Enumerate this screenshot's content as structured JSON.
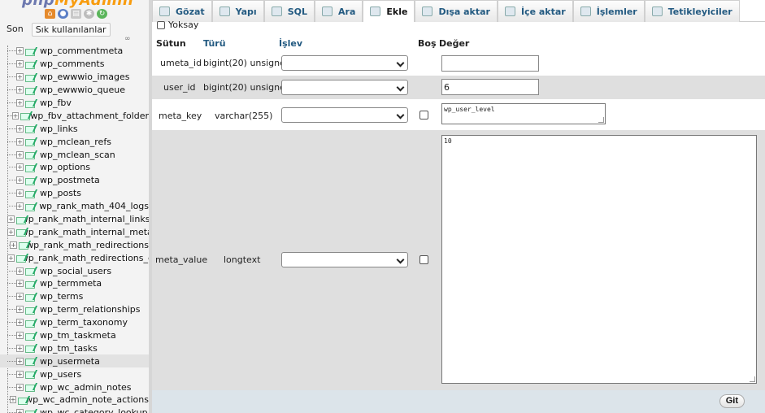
{
  "nav": {
    "logo_part1": "php",
    "logo_part2": "MyAdmin",
    "tab_recent": "Son",
    "tab_favorites": "Sık kullanılanlar",
    "link_icon": "link-icon",
    "active_item": "wp_usermeta",
    "tables": [
      "wp_commentmeta",
      "wp_comments",
      "wp_ewwwio_images",
      "wp_ewwwio_queue",
      "wp_fbv",
      "wp_fbv_attachment_folder",
      "wp_links",
      "wp_mclean_refs",
      "wp_mclean_scan",
      "wp_options",
      "wp_postmeta",
      "wp_posts",
      "wp_rank_math_404_logs",
      "wp_rank_math_internal_links",
      "wp_rank_math_internal_meta",
      "wp_rank_math_redirections",
      "wp_rank_math_redirections_cache",
      "wp_social_users",
      "wp_termmeta",
      "wp_terms",
      "wp_term_relationships",
      "wp_term_taxonomy",
      "wp_tm_taskmeta",
      "wp_tm_tasks",
      "wp_usermeta",
      "wp_users",
      "wp_wc_admin_notes",
      "wp_wc_admin_note_actions",
      "wp_wc_category_lookup"
    ]
  },
  "tabs": [
    {
      "label": "Gözat",
      "icon": "browse-icon"
    },
    {
      "label": "Yapı",
      "icon": "structure-icon"
    },
    {
      "label": "SQL",
      "icon": "sql-icon"
    },
    {
      "label": "Ara",
      "icon": "search-icon"
    },
    {
      "label": "Ekle",
      "icon": "insert-icon",
      "active": true
    },
    {
      "label": "Dışa aktar",
      "icon": "export-icon"
    },
    {
      "label": "İçe aktar",
      "icon": "import-icon"
    },
    {
      "label": "İşlemler",
      "icon": "wrench-icon"
    },
    {
      "label": "Tetikleyiciler",
      "icon": "triggers-icon"
    }
  ],
  "form": {
    "ignore_label": "Yoksay",
    "headers": {
      "column": "Sütun",
      "type": "Türü",
      "function": "İşlev",
      "null": "Boş",
      "value": "Değer"
    },
    "rows": [
      {
        "column": "umeta_id",
        "type": "bigint(20) unsigned",
        "value": ""
      },
      {
        "column": "user_id",
        "type": "bigint(20) unsigned",
        "value": "6"
      },
      {
        "column": "meta_key",
        "type": "varchar(255)",
        "value": "wp_user_level"
      },
      {
        "column": "meta_value",
        "type": "longtext",
        "value": "10"
      }
    ],
    "submit_label": "Git"
  }
}
